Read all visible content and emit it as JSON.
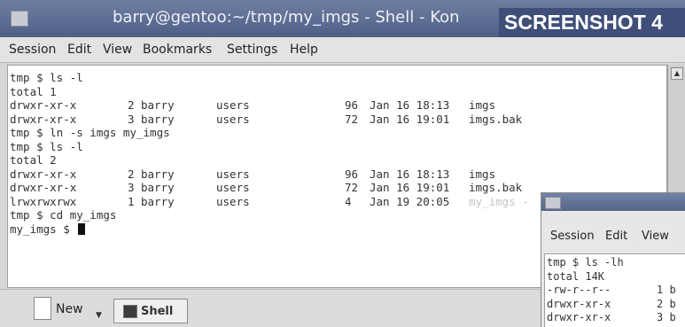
{
  "window": {
    "title": "barry@gentoo:~/tmp/my_imgs - Shell - Kon",
    "stamp": "SCREENSHOT 4"
  },
  "menubar": [
    "Session",
    "Edit",
    "View",
    "Bookmarks",
    "Settings",
    "Help"
  ],
  "terminal": {
    "lines": [
      {
        "type": "text",
        "text": "tmp $ ls -l"
      },
      {
        "type": "text",
        "text": "total 1"
      },
      {
        "type": "row",
        "perms": "drwxr-xr-x",
        "links": "2",
        "owner": "barry",
        "group": "users",
        "size": "96",
        "date": "Jan 16 18:13",
        "name": "imgs"
      },
      {
        "type": "row",
        "perms": "drwxr-xr-x",
        "links": "3",
        "owner": "barry",
        "group": "users",
        "size": "72",
        "date": "Jan 16 19:01",
        "name": "imgs.bak"
      },
      {
        "type": "text",
        "text": "tmp $ ln -s imgs my_imgs"
      },
      {
        "type": "text",
        "text": "tmp $ ls -l"
      },
      {
        "type": "text",
        "text": "total 2"
      },
      {
        "type": "row",
        "perms": "drwxr-xr-x",
        "links": "2",
        "owner": "barry",
        "group": "users",
        "size": "96",
        "date": "Jan 16 18:13",
        "name": "imgs"
      },
      {
        "type": "row",
        "perms": "drwxr-xr-x",
        "links": "3",
        "owner": "barry",
        "group": "users",
        "size": "72",
        "date": "Jan 16 19:01",
        "name": "imgs.bak"
      },
      {
        "type": "row",
        "perms": "lrwxrwxrwx",
        "links": "1",
        "owner": "barry",
        "group": "users",
        "size": "4",
        "date": "Jan 19 20:05",
        "name": "my_imgs -"
      },
      {
        "type": "text",
        "text": "tmp $ cd my_imgs"
      },
      {
        "type": "prompt",
        "text": "my_imgs $ "
      }
    ]
  },
  "tabbar": {
    "new_label": "New",
    "shell_tab_label": "Shell"
  },
  "second_window": {
    "menus": [
      "Session",
      "Edit",
      "View"
    ],
    "lines": [
      {
        "perm": "tmp $ ls -lh",
        "links": ""
      },
      {
        "perm": "total 14K",
        "links": ""
      },
      {
        "perm": "-rw-r--r--",
        "links": "1 b"
      },
      {
        "perm": "drwxr-xr-x",
        "links": "2 b"
      },
      {
        "perm": "drwxr-xr-x",
        "links": "3 b"
      }
    ]
  }
}
